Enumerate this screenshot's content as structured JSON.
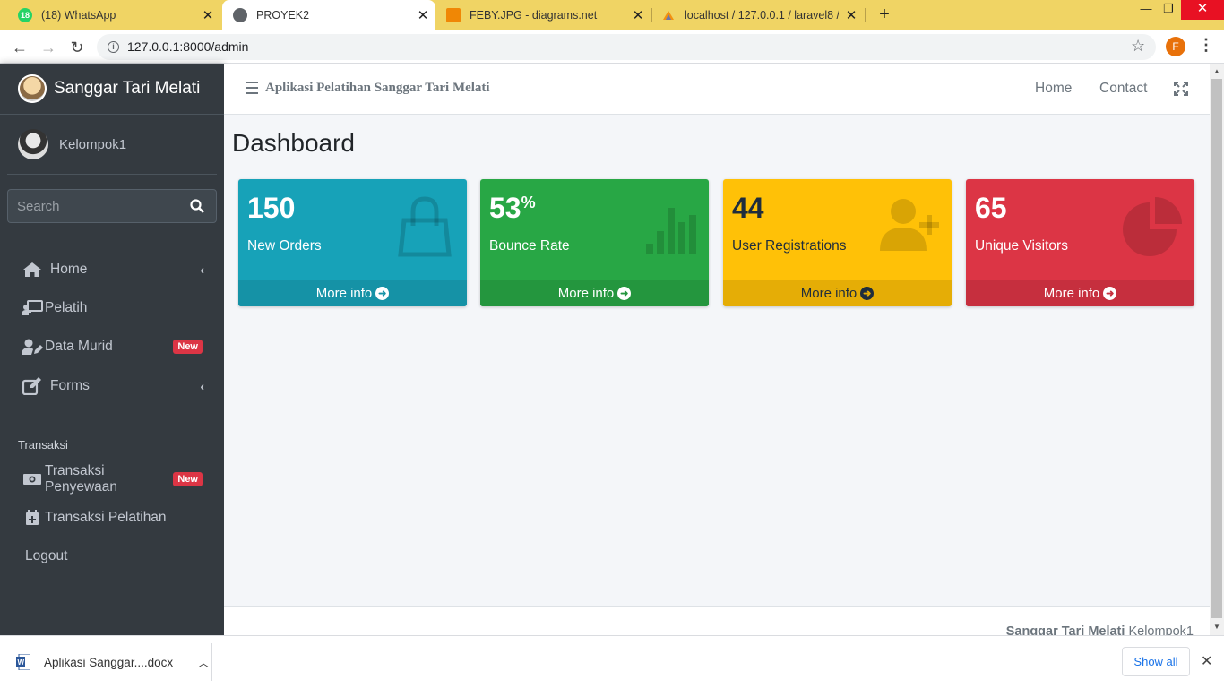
{
  "browser": {
    "tabs": [
      {
        "title": "(18) WhatsApp",
        "favicon_text": "18",
        "active": false
      },
      {
        "title": "PROYEK2",
        "active": true
      },
      {
        "title": "FEBY.JPG - diagrams.net",
        "active": false
      },
      {
        "title": "localhost / 127.0.0.1 / laravel8 / t",
        "active": false
      }
    ],
    "url": "127.0.0.1:8000/admin",
    "profile_initial": "F"
  },
  "sidebar": {
    "brand": "Sanggar Tari Melati",
    "user": "Kelompok1",
    "search_placeholder": "Search",
    "items": [
      {
        "label": "Home",
        "icon": "home-icon"
      },
      {
        "label": "Pelatih",
        "icon": "chalkboard-teacher-icon"
      },
      {
        "label": "Data Murid",
        "icon": "user-edit-icon",
        "badge": "New"
      },
      {
        "label": "Forms",
        "icon": "edit-icon"
      }
    ],
    "section_header": "Transaksi",
    "transaksi_items": [
      {
        "label": "Transaksi Penyewaan",
        "icon": "money-bill-icon",
        "badge": "New"
      },
      {
        "label": "Transaksi Pelatihan",
        "icon": "calendar-plus-icon"
      },
      {
        "label": "Logout"
      }
    ]
  },
  "topnav": {
    "title": "Aplikasi Pelatihan Sanggar Tari Melati",
    "links": [
      "Home",
      "Contact"
    ]
  },
  "page_title": "Dashboard",
  "boxes": [
    {
      "value": "150",
      "label": "New Orders",
      "more": "More info",
      "icon": "shopping-bag-icon",
      "color": "#17a2b8"
    },
    {
      "value": "53",
      "suffix": "%",
      "label": "Bounce Rate",
      "more": "More info",
      "icon": "bar-chart-icon",
      "color": "#28a745"
    },
    {
      "value": "44",
      "label": "User Registrations",
      "more": "More info",
      "icon": "user-plus-icon",
      "color": "#ffc107"
    },
    {
      "value": "65",
      "label": "Unique Visitors",
      "more": "More info",
      "icon": "pie-chart-icon",
      "color": "#dc3545"
    }
  ],
  "footer": {
    "brand": "Sanggar Tari Melati",
    "team": "Kelompok1"
  },
  "downloads": {
    "file": "Aplikasi Sanggar....docx",
    "show_all": "Show all"
  }
}
